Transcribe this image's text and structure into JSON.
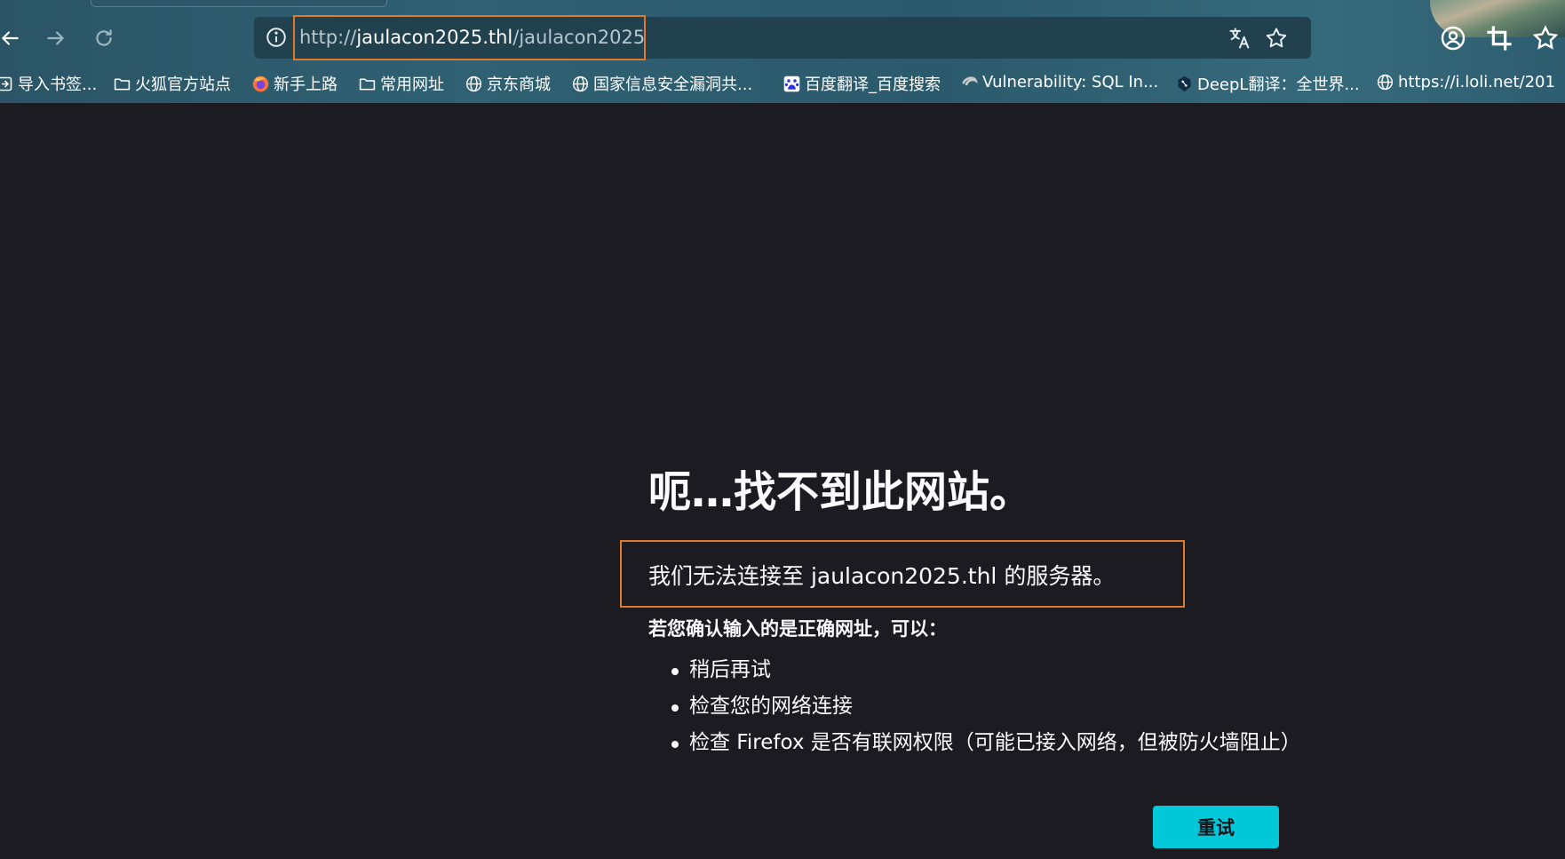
{
  "browser": {
    "url": {
      "scheme": "http://",
      "host": "jaulacon2025.thl",
      "path": "/jaulacon2025"
    },
    "nav": {
      "back": "back-icon",
      "forward": "forward-icon",
      "reload": "reload-icon"
    },
    "bookmarks": [
      {
        "label": "导入书签...",
        "icon": "import-icon"
      },
      {
        "label": "火狐官方站点",
        "icon": "folder-icon"
      },
      {
        "label": "新手上路",
        "icon": "firefox-icon"
      },
      {
        "label": "常用网址",
        "icon": "folder-icon"
      },
      {
        "label": "京东商城",
        "icon": "globe-icon"
      },
      {
        "label": "国家信息安全漏洞共...",
        "icon": "globe-icon"
      },
      {
        "label": "百度翻译_百度搜索",
        "icon": "baidu-icon"
      },
      {
        "label": "Vulnerability: SQL In...",
        "icon": "dvwa-icon"
      },
      {
        "label": "DeepL翻译：全世界...",
        "icon": "deepl-icon"
      },
      {
        "label": "https://i.loli.net/201",
        "icon": "globe-icon"
      }
    ]
  },
  "error_page": {
    "title": "呃…找不到此网站。",
    "description": "我们无法连接至 jaulacon2025.thl 的服务器。",
    "subtitle": "若您确认输入的是正确网址，可以：",
    "suggestions": [
      "稍后再试",
      "检查您的网络连接",
      "检查 Firefox 是否有联网权限（可能已接入网络，但被防火墙阻止）"
    ],
    "retry_label": "重试"
  },
  "colors": {
    "page_bg": "#1c1b22",
    "accent_button": "#00c8d8",
    "highlight_box": "#e07a2a",
    "chrome_bg": "#2f6173"
  }
}
